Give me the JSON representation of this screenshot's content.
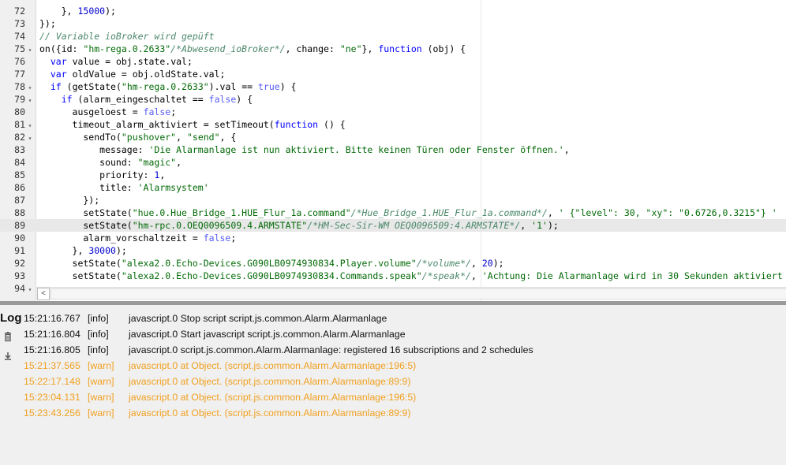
{
  "editor": {
    "lines": [
      {
        "num": "72",
        "fold": "",
        "parts": [
          [
            "",
            "    }, "
          ],
          [
            "n",
            "15000"
          ],
          [
            "",
            "); "
          ]
        ]
      },
      {
        "num": "73",
        "fold": "",
        "parts": [
          [
            "",
            "});"
          ]
        ]
      },
      {
        "num": "74",
        "fold": "",
        "parts": [
          [
            "c",
            "// Variable ioBroker wird gepüft"
          ]
        ]
      },
      {
        "num": "75",
        "fold": "▾",
        "parts": [
          [
            "",
            "on({id: "
          ],
          [
            "s",
            "\"hm-rega.0.2633\""
          ],
          [
            "c",
            "/*Abwesend_ioBroker*/"
          ],
          [
            "",
            ", change: "
          ],
          [
            "s",
            "\"ne\""
          ],
          [
            "",
            "}, "
          ],
          [
            "k",
            "function"
          ],
          [
            "",
            " (obj) {"
          ]
        ]
      },
      {
        "num": "76",
        "fold": "",
        "parts": [
          [
            "",
            "  "
          ],
          [
            "k",
            "var"
          ],
          [
            "",
            " value = obj.state.val;"
          ]
        ]
      },
      {
        "num": "77",
        "fold": "",
        "parts": [
          [
            "",
            "  "
          ],
          [
            "k",
            "var"
          ],
          [
            "",
            " oldValue = obj.oldState.val;"
          ]
        ]
      },
      {
        "num": "78",
        "fold": "▾",
        "parts": [
          [
            "",
            "  "
          ],
          [
            "k",
            "if"
          ],
          [
            "",
            " (getState("
          ],
          [
            "s",
            "\"hm-rega.0.2633\""
          ],
          [
            "",
            ").val == "
          ],
          [
            "b",
            "true"
          ],
          [
            "",
            ") {"
          ]
        ]
      },
      {
        "num": "79",
        "fold": "▾",
        "parts": [
          [
            "",
            "    "
          ],
          [
            "k",
            "if"
          ],
          [
            "",
            " (alarm_eingeschaltet == "
          ],
          [
            "b",
            "false"
          ],
          [
            "",
            ") {"
          ]
        ]
      },
      {
        "num": "80",
        "fold": "",
        "parts": [
          [
            "",
            "      ausgeloest = "
          ],
          [
            "b",
            "false"
          ],
          [
            "",
            ";"
          ]
        ]
      },
      {
        "num": "81",
        "fold": "▾",
        "parts": [
          [
            "",
            "      timeout_alarm_aktiviert = setTimeout("
          ],
          [
            "k",
            "function"
          ],
          [
            "",
            " () {"
          ]
        ]
      },
      {
        "num": "82",
        "fold": "▾",
        "parts": [
          [
            "",
            "        sendTo("
          ],
          [
            "s",
            "\"pushover\""
          ],
          [
            "",
            ", "
          ],
          [
            "s",
            "\"send\""
          ],
          [
            "",
            ", {"
          ]
        ]
      },
      {
        "num": "83",
        "fold": "",
        "parts": [
          [
            "",
            "           message: "
          ],
          [
            "s",
            "'Die Alarmanlage ist nun aktiviert. Bitte keinen Türen oder Fenster öffnen.'"
          ],
          [
            "",
            ","
          ]
        ]
      },
      {
        "num": "84",
        "fold": "",
        "parts": [
          [
            "",
            "           sound: "
          ],
          [
            "s",
            "\"magic\""
          ],
          [
            "",
            ","
          ]
        ]
      },
      {
        "num": "85",
        "fold": "",
        "parts": [
          [
            "",
            "           priority: "
          ],
          [
            "n",
            "1"
          ],
          [
            "",
            ","
          ]
        ]
      },
      {
        "num": "86",
        "fold": "",
        "parts": [
          [
            "",
            "           title: "
          ],
          [
            "s",
            "'Alarmsystem'"
          ]
        ]
      },
      {
        "num": "87",
        "fold": "",
        "parts": [
          [
            "",
            "        });"
          ]
        ]
      },
      {
        "num": "88",
        "fold": "",
        "parts": [
          [
            "",
            "        setState("
          ],
          [
            "s",
            "\"hue.0.Hue_Bridge_1.HUE_Flur_1a.command\""
          ],
          [
            "c",
            "/*Hue_Bridge_1.HUE_Flur_1a.command*/"
          ],
          [
            "",
            ", "
          ],
          [
            "s",
            "' {\"level\": 30, \"xy\": \"0.6726,0.3215\"} '"
          ]
        ]
      },
      {
        "num": "89",
        "fold": "",
        "parts": [
          [
            "",
            "        setState("
          ],
          [
            "s",
            "\"hm-rpc.0.OEQ0096509.4.ARMSTATE\""
          ],
          [
            "c",
            "/*HM-Sec-Sir-WM OEQ0096509:4.ARMSTATE*/"
          ],
          [
            "",
            ", "
          ],
          [
            "s",
            "'1'"
          ],
          [
            "",
            ");"
          ]
        ]
      },
      {
        "num": "90",
        "fold": "",
        "parts": [
          [
            "",
            "        alarm_vorschaltzeit = "
          ],
          [
            "b",
            "false"
          ],
          [
            "",
            ";"
          ]
        ]
      },
      {
        "num": "91",
        "fold": "",
        "parts": [
          [
            "",
            "      }, "
          ],
          [
            "n",
            "30000"
          ],
          [
            "",
            ");"
          ]
        ]
      },
      {
        "num": "92",
        "fold": "",
        "parts": [
          [
            "",
            "      setState("
          ],
          [
            "s",
            "\"alexa2.0.Echo-Devices.G090LB0974930834.Player.volume\""
          ],
          [
            "c",
            "/*volume*/"
          ],
          [
            "",
            ", "
          ],
          [
            "n",
            "20"
          ],
          [
            "",
            ");"
          ]
        ]
      },
      {
        "num": "93",
        "fold": "",
        "parts": [
          [
            "",
            "      setState("
          ],
          [
            "s",
            "\"alexa2.0.Echo-Devices.G090LB0974930834.Commands.speak\""
          ],
          [
            "c",
            "/*speak*/"
          ],
          [
            "",
            ", "
          ],
          [
            "s",
            "'Achtung: Die Alarmanlage wird in 30 Sekunden aktiviert"
          ]
        ]
      },
      {
        "num": "94",
        "fold": "▾",
        "parts": [
          [
            "",
            "      "
          ]
        ]
      }
    ],
    "scroll_left_arrow": "<"
  },
  "log": {
    "title": "Log",
    "entries": [
      {
        "time": "15:21:16.767",
        "level": "[info]",
        "message": "javascript.0 Stop script script.js.common.Alarm.Alarmanlage",
        "type": "info"
      },
      {
        "time": "15:21:16.804",
        "level": "[info]",
        "message": "javascript.0 Start javascript script.js.common.Alarm.Alarmanlage",
        "type": "info"
      },
      {
        "time": "15:21:16.805",
        "level": "[info]",
        "message": "javascript.0 script.js.common.Alarm.Alarmanlage: registered 16 subscriptions and 2 schedules",
        "type": "info"
      },
      {
        "time": "15:21:37.565",
        "level": "[warn]",
        "message": "javascript.0 at Object. (script.js.common.Alarm.Alarmanlage:196:5)",
        "type": "warn"
      },
      {
        "time": "15:22:17.148",
        "level": "[warn]",
        "message": "javascript.0 at Object. (script.js.common.Alarm.Alarmanlage:89:9)",
        "type": "warn"
      },
      {
        "time": "15:23:04.131",
        "level": "[warn]",
        "message": "javascript.0 at Object. (script.js.common.Alarm.Alarmanlage:196:5)",
        "type": "warn"
      },
      {
        "time": "15:23:43.256",
        "level": "[warn]",
        "message": "javascript.0 at Object. (script.js.common.Alarm.Alarmanlage:89:9)",
        "type": "warn"
      }
    ]
  },
  "colors": {
    "warn": "#f0a020",
    "info": "#111111",
    "keyword": "#0000ff",
    "string": "#036a07",
    "comment": "#4c886b"
  },
  "icons": {
    "clear_log": "trash-icon",
    "download_log": "download-icon"
  }
}
